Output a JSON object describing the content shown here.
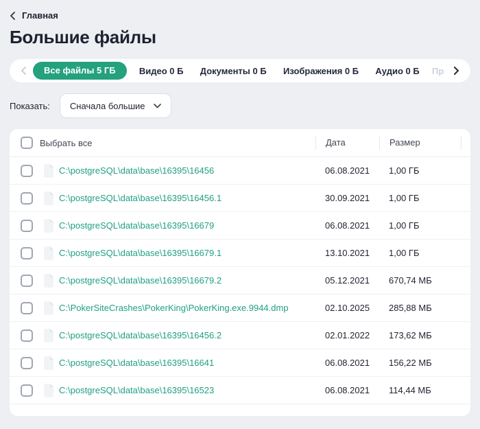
{
  "breadcrumb": {
    "back_label": "Главная"
  },
  "page": {
    "title": "Большие файлы"
  },
  "tabs": {
    "items": [
      {
        "label": "Все файлы 5 ГБ",
        "active": true
      },
      {
        "label": "Видео 0 Б"
      },
      {
        "label": "Документы 0 Б"
      },
      {
        "label": "Изображения 0 Б"
      },
      {
        "label": "Аудио 0 Б"
      },
      {
        "label": "Пр",
        "truncated": true
      }
    ]
  },
  "filter": {
    "label": "Показать:",
    "selected": "Сначала большие"
  },
  "table": {
    "select_all_label": "Выбрать все",
    "columns": {
      "date": "Дата",
      "size": "Размер"
    },
    "rows": [
      {
        "path": "C:\\postgreSQL\\data\\base\\16395\\16456",
        "date": "06.08.2021",
        "size": "1,00 ГБ"
      },
      {
        "path": "C:\\postgreSQL\\data\\base\\16395\\16456.1",
        "date": "30.09.2021",
        "size": "1,00 ГБ"
      },
      {
        "path": "C:\\postgreSQL\\data\\base\\16395\\16679",
        "date": "06.08.2021",
        "size": "1,00 ГБ"
      },
      {
        "path": "C:\\postgreSQL\\data\\base\\16395\\16679.1",
        "date": "13.10.2021",
        "size": "1,00 ГБ"
      },
      {
        "path": "C:\\postgreSQL\\data\\base\\16395\\16679.2",
        "date": "05.12.2021",
        "size": "670,74 МБ"
      },
      {
        "path": "C:\\PokerSiteCrashes\\PokerKing\\PokerKing.exe.9944.dmp",
        "date": "02.10.2025",
        "size": "285,88 МБ"
      },
      {
        "path": "C:\\postgreSQL\\data\\base\\16395\\16456.2",
        "date": "02.01.2022",
        "size": "173,62 МБ"
      },
      {
        "path": "C:\\postgreSQL\\data\\base\\16395\\16641",
        "date": "06.08.2021",
        "size": "156,22 МБ"
      },
      {
        "path": "C:\\postgreSQL\\data\\base\\16395\\16523",
        "date": "06.08.2021",
        "size": "114,44 МБ"
      }
    ]
  },
  "colors": {
    "accent_green": "#24a17d",
    "link_green": "#1f9f81",
    "page_bg": "#edeff3"
  }
}
